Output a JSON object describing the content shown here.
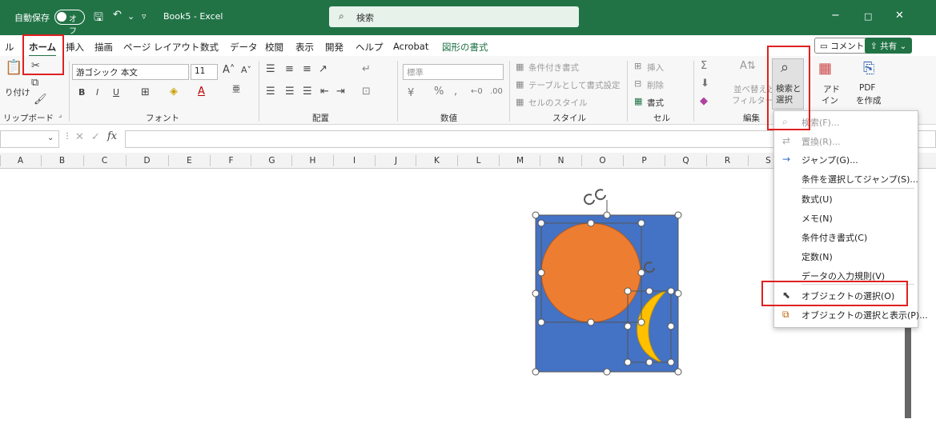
{
  "titlebar": {
    "autosave_label": "自動保存",
    "autosave_state": "オフ",
    "filename": "Book5 - Excel",
    "search_placeholder": "検索",
    "minimize": "−",
    "maximize": "□",
    "close": "✕"
  },
  "tabs": {
    "file_partial": "ル",
    "home": "ホーム",
    "insert": "挿入",
    "draw": "描画",
    "page_layout": "ページ レイアウト",
    "formulas": "数式",
    "data": "データ",
    "review": "校閲",
    "view": "表示",
    "developer": "開発",
    "help": "ヘルプ",
    "acrobat": "Acrobat",
    "shape_format": "図形の書式",
    "comments": "コメント",
    "share": "共有"
  },
  "ribbon": {
    "clipboard": {
      "paste": "り付け",
      "group": "リップボード"
    },
    "font": {
      "name": "游ゴシック 本文",
      "size": "11",
      "bold": "B",
      "italic": "I",
      "underline": "U",
      "group": "フォント"
    },
    "alignment": {
      "group": "配置"
    },
    "number": {
      "format": "標準",
      "percent": "%",
      "group": "数値"
    },
    "styles": {
      "conditional": "条件付き書式",
      "table": "テーブルとして書式設定",
      "cell_styles": "セルのスタイル",
      "group": "スタイル"
    },
    "cells": {
      "insert": "挿入",
      "delete": "削除",
      "format": "書式",
      "group": "セル"
    },
    "editing": {
      "sort_line1": "並べ替えと",
      "sort_line2": "フィルター",
      "find_line1": "検索と",
      "find_line2": "選択",
      "group": "編集"
    },
    "addins": {
      "line1": "アド",
      "line2": "イン"
    },
    "pdf": {
      "line1": "PDF",
      "line2": "を作成"
    }
  },
  "formula_bar": {
    "fx": "fx"
  },
  "columns": [
    "A",
    "B",
    "C",
    "D",
    "E",
    "F",
    "G",
    "H",
    "I",
    "J",
    "K",
    "L",
    "M",
    "N",
    "O",
    "P",
    "Q",
    "R",
    "S"
  ],
  "menu": {
    "items": [
      {
        "label": "検索(F)...",
        "enabled": false
      },
      {
        "label": "置換(R)...",
        "enabled": false
      },
      {
        "label": "ジャンプ(G)...",
        "enabled": true
      },
      {
        "label": "条件を選択してジャンプ(S)...",
        "enabled": true
      },
      {
        "label": "数式(U)",
        "enabled": true
      },
      {
        "label": "メモ(N)",
        "enabled": true
      },
      {
        "label": "条件付き書式(C)",
        "enabled": true
      },
      {
        "label": "定数(N)",
        "enabled": true
      },
      {
        "label": "データの入力規則(V)",
        "enabled": true
      },
      {
        "label": "オブジェクトの選択(O)",
        "enabled": true
      },
      {
        "label": "オブジェクトの選択と表示(P)...",
        "enabled": true
      }
    ]
  },
  "colors": {
    "excel_green": "#217346",
    "shape_blue": "#4472C4",
    "sun_orange": "#ED7D31",
    "moon_yellow": "#FFC000",
    "highlight_red": "#E02020"
  }
}
